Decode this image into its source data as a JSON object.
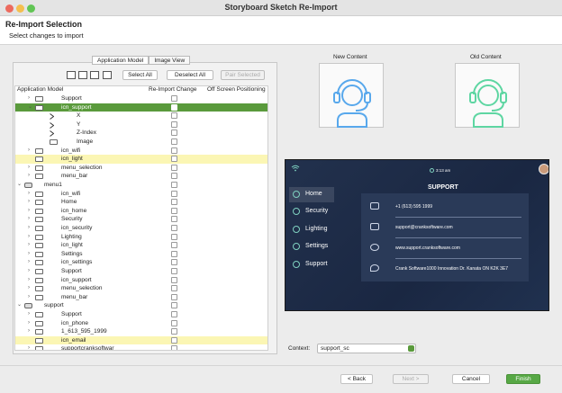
{
  "window": {
    "title": "Storyboard Sketch Re-Import"
  },
  "header": {
    "title": "Re-Import Selection",
    "subtitle": "Select changes to import"
  },
  "tabs": [
    {
      "label": "Application Model"
    },
    {
      "label": "Image View"
    }
  ],
  "toolbar": {
    "select_all": "Select All",
    "deselect_all": "Deselect All",
    "pair_selected": "Pair Selected"
  },
  "tree": {
    "columns": {
      "model": "Application Model",
      "reimport": "Re-Import Change",
      "offscreen": "Off Screen Positioning"
    },
    "rows": [
      {
        "label": "Support"
      },
      {
        "label": "icn_support"
      },
      {
        "label": "X"
      },
      {
        "label": "Y"
      },
      {
        "label": "Z-Index"
      },
      {
        "label": "Image"
      },
      {
        "label": "icn_wifi"
      },
      {
        "label": "icn_light"
      },
      {
        "label": "menu_selection"
      },
      {
        "label": "menu_bar"
      },
      {
        "label": "menu1"
      },
      {
        "label": "icn_wifi"
      },
      {
        "label": "Home"
      },
      {
        "label": "icn_home"
      },
      {
        "label": "Security"
      },
      {
        "label": "icn_security"
      },
      {
        "label": "Lighting"
      },
      {
        "label": "icn_light"
      },
      {
        "label": "Settings"
      },
      {
        "label": "icn_settings"
      },
      {
        "label": "Support"
      },
      {
        "label": "icn_support"
      },
      {
        "label": "menu_selection"
      },
      {
        "label": "menu_bar"
      },
      {
        "label": "support"
      },
      {
        "label": "Support"
      },
      {
        "label": "icn_phone"
      },
      {
        "label": "1_613_595_1999"
      },
      {
        "label": "icn_email"
      },
      {
        "label": "supportcranksoftwar"
      }
    ]
  },
  "preview": {
    "new_label": "New Content",
    "old_label": "Old Content",
    "new_color": "#58a8ec",
    "old_color": "#5ed6a2"
  },
  "device": {
    "time": "3:13 am",
    "heading": "SUPPORT",
    "menu": [
      {
        "label": "Home"
      },
      {
        "label": "Security"
      },
      {
        "label": "Lighting"
      },
      {
        "label": "Settings"
      },
      {
        "label": "Support"
      }
    ],
    "contacts": [
      {
        "text": "+1 (613) 595 1999",
        "icon": "phone-icon"
      },
      {
        "text": "support@cranksoftware.com",
        "icon": "email-icon"
      },
      {
        "text": "www.support.cranksoftware.com",
        "icon": "globe-icon"
      },
      {
        "text": "Crank Software1000 Innovation Dr. Kanata ON  K2K 3E7",
        "icon": "location-icon"
      }
    ]
  },
  "context": {
    "label": "Context:",
    "value": "support_sc"
  },
  "footer": {
    "back": "< Back",
    "next": "Next >",
    "cancel": "Cancel",
    "finish": "Finish"
  }
}
